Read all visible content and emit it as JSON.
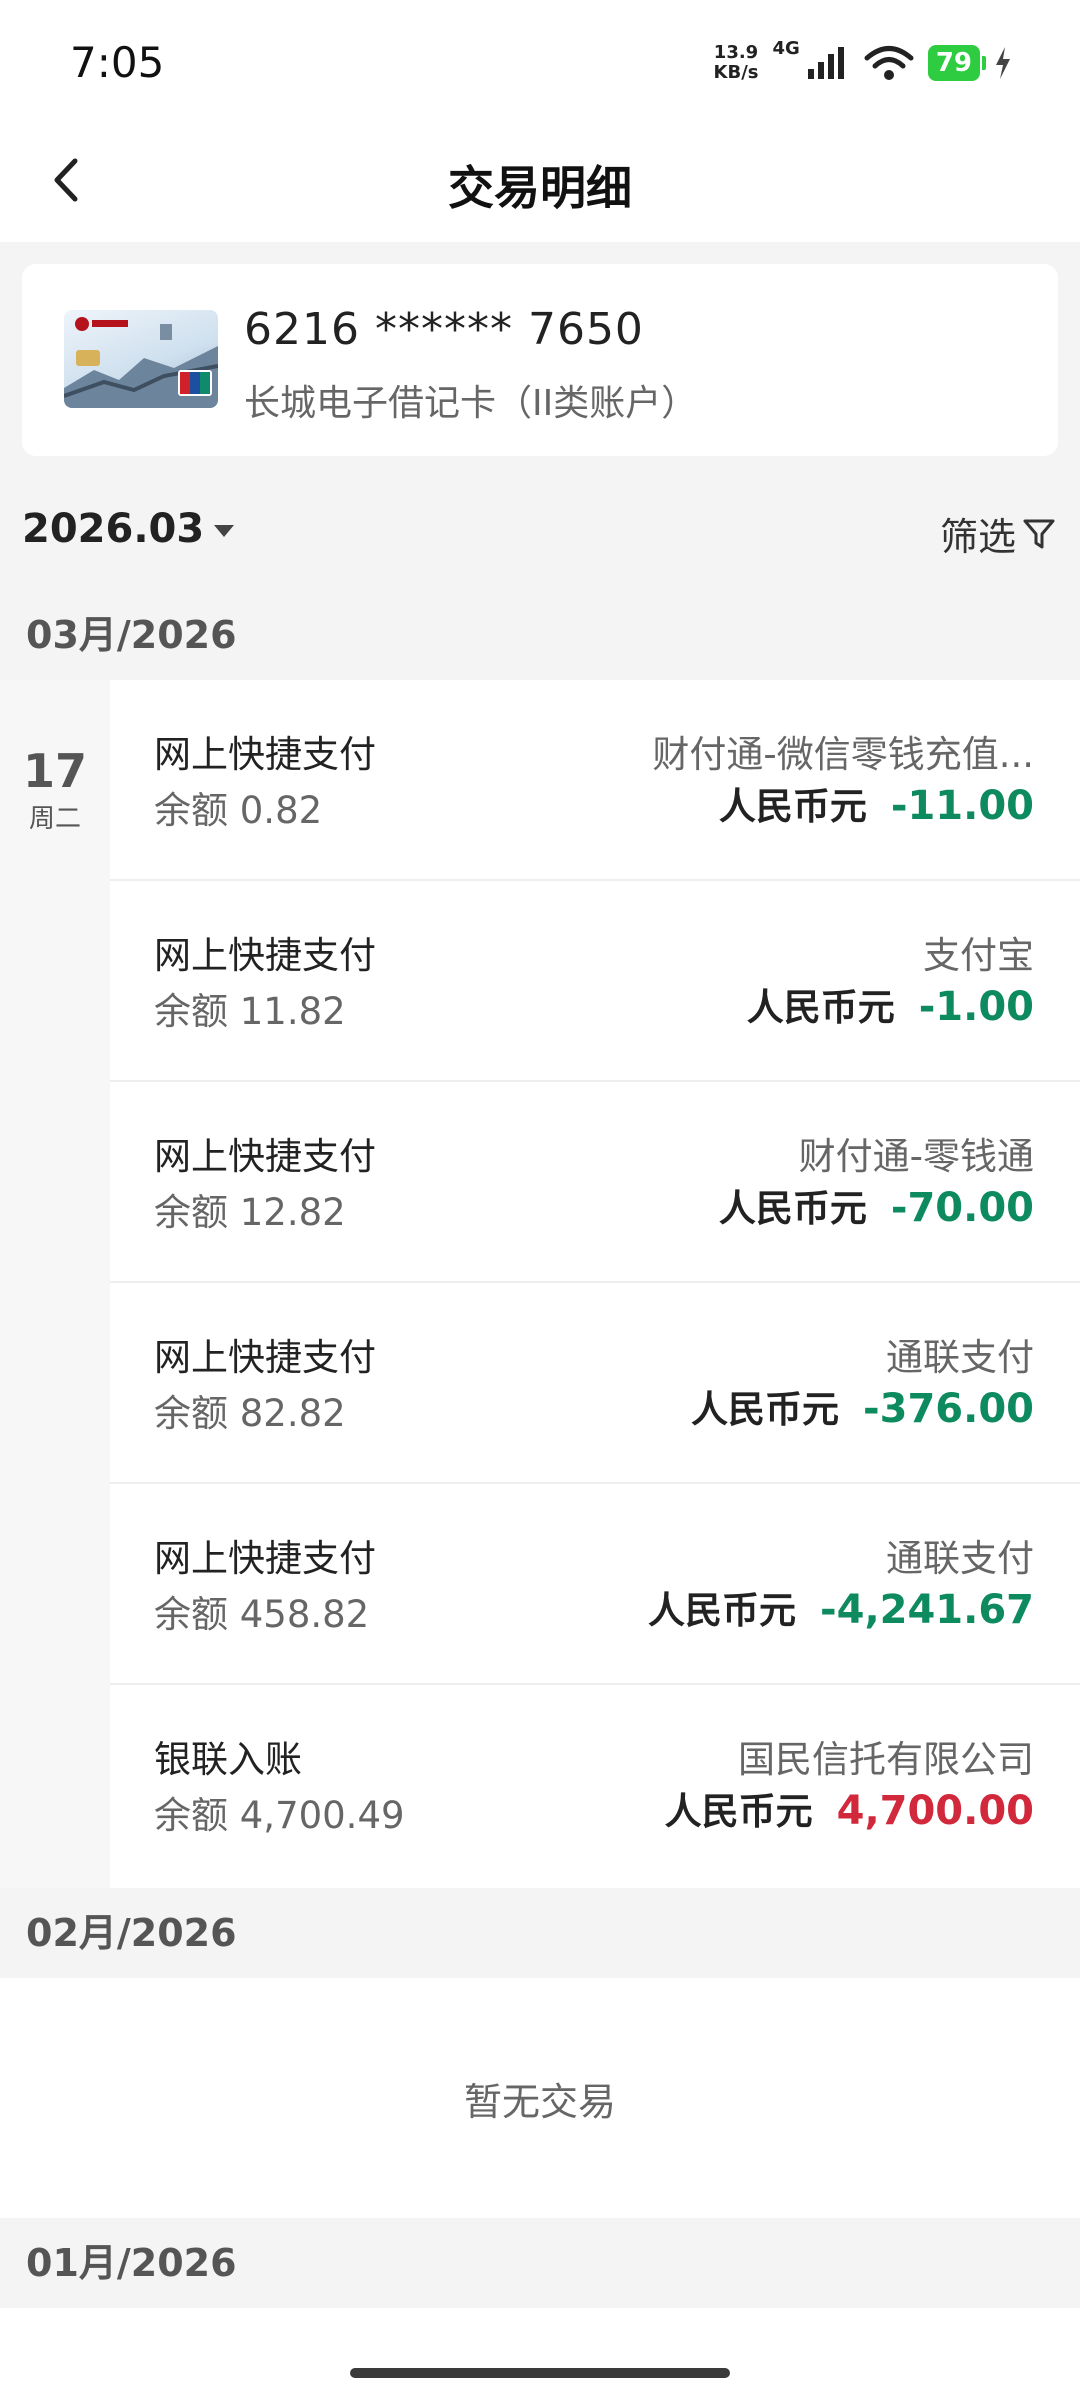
{
  "status_bar": {
    "time": "7:05",
    "net_speed_value": "13.9",
    "net_speed_unit": "KB/s",
    "network": "4G",
    "battery": "79"
  },
  "header": {
    "title": "交易明细"
  },
  "card": {
    "number": "6216 ****** 7650",
    "type": "长城电子借记卡（II类账户）"
  },
  "period": {
    "value": "2026.03",
    "filter_label": "筛选"
  },
  "months": [
    {
      "label": "03月/2026",
      "date_groups": [
        {
          "day": "17",
          "weekday": "周二",
          "transactions": [
            {
              "type": "网上快捷支付",
              "balance": "余额 0.82",
              "counterparty": "财付通-微信零钱充值...",
              "currency": "人民币元",
              "amount": "-11.00",
              "direction": "out"
            },
            {
              "type": "网上快捷支付",
              "balance": "余额 11.82",
              "counterparty": "支付宝",
              "currency": "人民币元",
              "amount": "-1.00",
              "direction": "out"
            },
            {
              "type": "网上快捷支付",
              "balance": "余额 12.82",
              "counterparty": "财付通-零钱通",
              "currency": "人民币元",
              "amount": "-70.00",
              "direction": "out"
            },
            {
              "type": "网上快捷支付",
              "balance": "余额 82.82",
              "counterparty": "通联支付",
              "currency": "人民币元",
              "amount": "-376.00",
              "direction": "out"
            },
            {
              "type": "网上快捷支付",
              "balance": "余额 458.82",
              "counterparty": "通联支付",
              "currency": "人民币元",
              "amount": "-4,241.67",
              "direction": "out"
            },
            {
              "type": "银联入账",
              "balance": "余额 4,700.49",
              "counterparty": "国民信托有限公司",
              "currency": "人民币元",
              "amount": "4,700.00",
              "direction": "in"
            }
          ]
        }
      ]
    },
    {
      "label": "02月/2026",
      "empty_text": "暂无交易"
    },
    {
      "label": "01月/2026"
    }
  ],
  "colors": {
    "amount_out": "#0e8a5f",
    "amount_in": "#d2283c"
  }
}
